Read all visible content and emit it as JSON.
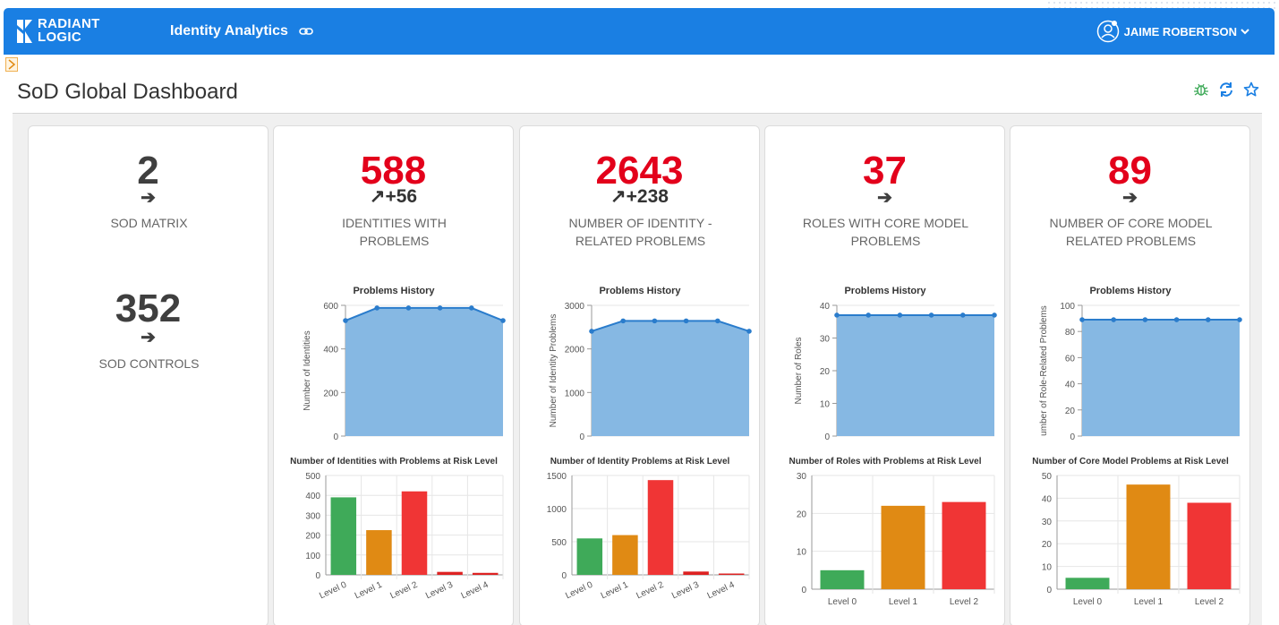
{
  "header": {
    "logo_line1": "RADIANT",
    "logo_line2": "LOGIC",
    "app_name": "Identity Analytics",
    "user_name": "JAIME ROBERTSON",
    "brand_color": "#1a7fe3"
  },
  "page": {
    "title": "SoD Global Dashboard",
    "icons": [
      "bug-icon",
      "refresh-icon",
      "star-icon"
    ]
  },
  "left_card": {
    "items": [
      {
        "value": "2",
        "arrow": "➔",
        "label": "SOD MATRIX"
      },
      {
        "value": "352",
        "arrow": "➔",
        "label": "SOD CONTROLS"
      }
    ]
  },
  "cards": [
    {
      "value": "588",
      "delta": "↗+56",
      "label_line1": "IDENTITIES WITH",
      "label_line2": "PROBLEMS",
      "history": {
        "title": "Problems History",
        "ylabel": "Number of Identities",
        "yticks": [
          0,
          200,
          400,
          600
        ],
        "ymax": 600,
        "values": [
          530,
          588,
          588,
          588,
          588,
          530
        ]
      },
      "bars": {
        "title": "Number of Identities with Problems at Risk Level",
        "categories": [
          "Level 0",
          "Level 1",
          "Level 2",
          "Level 3",
          "Level 4"
        ],
        "values": [
          390,
          225,
          420,
          15,
          10
        ],
        "yticks": [
          0,
          100,
          200,
          300,
          400,
          500
        ],
        "ymax": 500,
        "rotated": true
      }
    },
    {
      "value": "2643",
      "delta": "↗+238",
      "label_line1": "NUMBER OF IDENTITY -",
      "label_line2": "RELATED PROBLEMS",
      "history": {
        "title": "Problems History",
        "ylabel": "Number of Identity Problems",
        "yticks": [
          0,
          1000,
          2000,
          3000
        ],
        "ymax": 3000,
        "values": [
          2405,
          2643,
          2643,
          2643,
          2643,
          2405
        ]
      },
      "bars": {
        "title": "Number of Identity Problems at Risk Level",
        "categories": [
          "Level 0",
          "Level 1",
          "Level 2",
          "Level 3",
          "Level 4"
        ],
        "values": [
          550,
          600,
          1430,
          50,
          20
        ],
        "yticks": [
          0,
          500,
          1000,
          1500
        ],
        "ymax": 1500,
        "rotated": true
      }
    },
    {
      "value": "37",
      "delta": "➔",
      "label_line1": "ROLES WITH CORE MODEL",
      "label_line2": "PROBLEMS",
      "history": {
        "title": "Problems History",
        "ylabel": "Number of Roles",
        "yticks": [
          0,
          10,
          20,
          30,
          40
        ],
        "ymax": 40,
        "values": [
          37,
          37,
          37,
          37,
          37,
          37
        ]
      },
      "bars": {
        "title": "Number of Roles with Problems at Risk Level",
        "categories": [
          "Level 0",
          "Level 1",
          "Level 2"
        ],
        "values": [
          5,
          22,
          23
        ],
        "yticks": [
          0,
          10,
          20,
          30
        ],
        "ymax": 30,
        "rotated": false
      }
    },
    {
      "value": "89",
      "delta": "➔",
      "label_line1": "NUMBER OF CORE MODEL",
      "label_line2": "RELATED PROBLEMS",
      "history": {
        "title": "Problems History",
        "ylabel": "umber of Role-Related Problems",
        "yticks": [
          0,
          20,
          40,
          60,
          80,
          100
        ],
        "ymax": 100,
        "values": [
          89,
          89,
          89,
          89,
          89,
          89
        ]
      },
      "bars": {
        "title": "Number of Core Model Problems at Risk Level",
        "categories": [
          "Level 0",
          "Level 1",
          "Level 2"
        ],
        "values": [
          5,
          46,
          38
        ],
        "yticks": [
          0,
          10,
          20,
          30,
          40,
          50
        ],
        "ymax": 50,
        "rotated": false
      }
    }
  ],
  "colors": {
    "area_fill": "#86b8e3",
    "line": "#2a7ccc",
    "level0": "#3faa59",
    "level1": "#e08a14",
    "level2": "#f03535",
    "level3": "#dd2222",
    "level4": "#dd2222",
    "kpi_red": "#e3001b"
  }
}
